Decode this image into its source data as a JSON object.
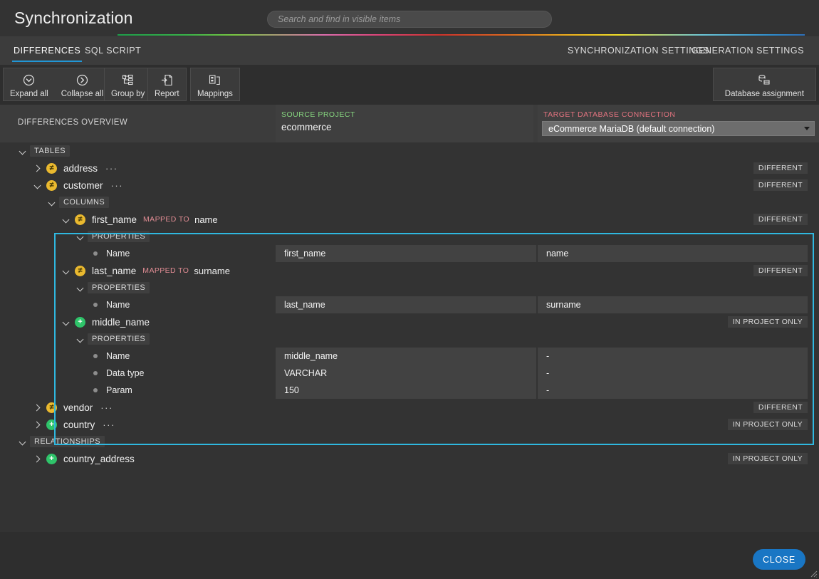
{
  "header": {
    "title": "Synchronization",
    "search_placeholder": "Search and find in visible items"
  },
  "tabs": {
    "differences": "DIFFERENCES",
    "sql_script": "SQL SCRIPT",
    "synchronization_settings": "SYNCHRONIZATION SETTINGS",
    "generation_settings": "GENERATION SETTINGS"
  },
  "toolbar": {
    "expand_all": "Expand all",
    "collapse_all": "Collapse all",
    "group_by": "Group by",
    "report": "Report",
    "mappings": "Mappings",
    "database_assignment": "Database assignment"
  },
  "overview": {
    "label": "DIFFERENCES OVERVIEW",
    "source_caption": "SOURCE PROJECT",
    "source_value": "ecommerce",
    "target_caption": "TARGET DATABASE CONNECTION",
    "target_value": "eCommerce MariaDB (default connection)"
  },
  "sections": {
    "tables": "TABLES",
    "relationships": "RELATIONSHIPS",
    "columns": "COLUMNS",
    "properties": "PROPERTIES"
  },
  "labels": {
    "mapped_to": "MAPPED TO",
    "dots": "···",
    "empty_value": "-"
  },
  "status": {
    "different": "DIFFERENT",
    "in_project_only": "IN PROJECT ONLY"
  },
  "nodes": {
    "address": "address",
    "customer": "customer",
    "vendor": "vendor",
    "country": "country",
    "country_address": "country_address",
    "first_name": "first_name",
    "first_name_mapped": "name",
    "last_name": "last_name",
    "last_name_mapped": "surname",
    "middle_name": "middle_name"
  },
  "props": {
    "name": "Name",
    "data_type": "Data type",
    "param": "Param"
  },
  "values": {
    "first_name_src": "first_name",
    "first_name_tgt": "name",
    "last_name_src": "last_name",
    "last_name_tgt": "surname",
    "middle_name_src": "middle_name",
    "middle_name_tgt": "-",
    "middle_type_src": "VARCHAR",
    "middle_type_tgt": "-",
    "middle_param_src": "150",
    "middle_param_tgt": "-"
  },
  "footer": {
    "close": "CLOSE"
  },
  "colors": {
    "accent_blue": "#2196d6",
    "selection_border": "#2fb8e0",
    "source_green": "#86d57f",
    "target_red": "#e2737f",
    "diff_icon": "#eab92f",
    "add_icon": "#2fc46a",
    "close_button": "#1976c4"
  }
}
